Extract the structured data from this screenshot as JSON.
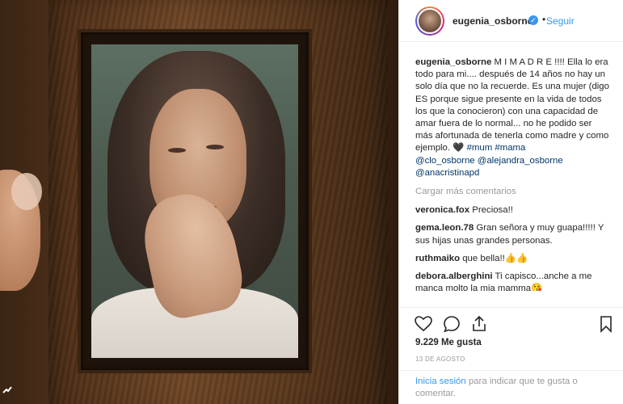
{
  "post": {
    "username": "eugenia_osborne",
    "follow_label": "Seguir",
    "dot": "•",
    "caption_user": "eugenia_osborne",
    "caption_text": " M I M A D R E !!!! Ella lo era todo para mi.... después de 14 años no hay un solo día que no la recuerde. Es una mujer (digo ES porque sigue presente en la vida de todos los que la conocieron) con una capacidad de amar fuera de lo normal... no he podido ser más afortunada de tenerla como madre y como ejemplo. 🖤 ",
    "caption_tags": "#mum #mama",
    "caption_mentions": "@clo_osborne @alejandra_osborne @anacristinapd",
    "load_more": "Cargar más comentarios",
    "comments": [
      {
        "user": "veronica.fox",
        "text": " Preciosa!!"
      },
      {
        "user": "gema.leon.78",
        "text": " Gran señora y muy guapa!!!!! Y sus hijas unas grandes personas."
      },
      {
        "user": "ruthmaiko",
        "text": " que bella!!👍👍"
      },
      {
        "user": "debora.alberghini",
        "text": " Ti capisco...anche a me manca molto la mia mamma😘"
      }
    ],
    "likes": "9.229 Me gusta",
    "date": "13 DE AGOSTO",
    "footer_login": "Inicia sesión",
    "footer_text": " para indicar que te gusta o comentar."
  },
  "icons": {
    "verified": "verified-badge-icon",
    "like": "heart-icon",
    "comment": "comment-bubble-icon",
    "share": "share-icon",
    "save": "bookmark-icon"
  },
  "colors": {
    "link_blue": "#3897f0",
    "mention": "#003569",
    "muted": "#999999",
    "text": "#262626"
  }
}
